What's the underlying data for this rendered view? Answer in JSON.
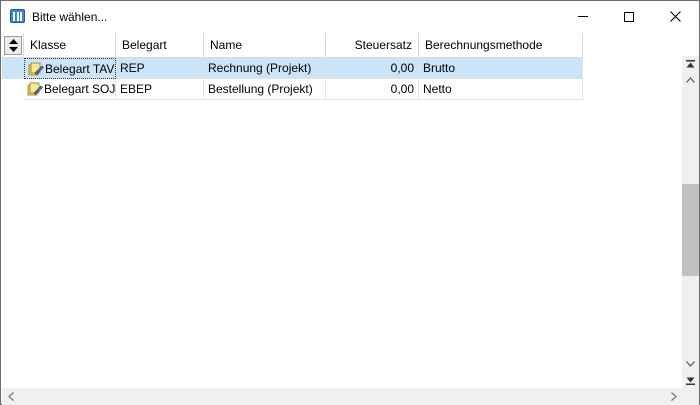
{
  "window": {
    "title": "Bitte wählen..."
  },
  "columns": [
    {
      "key": "klasse",
      "label": "Klasse"
    },
    {
      "key": "belegart",
      "label": "Belegart"
    },
    {
      "key": "name",
      "label": "Name"
    },
    {
      "key": "steuersatz",
      "label": "Steuersatz"
    },
    {
      "key": "methode",
      "label": "Berechnungsmethode"
    }
  ],
  "rows": [
    {
      "klasse": "Belegart TAV",
      "belegart": "REP",
      "name": "Rechnung (Projekt)",
      "steuersatz": "0,00",
      "methode": "Brutto",
      "selected": true
    },
    {
      "klasse": "Belegart SOJ",
      "belegart": "EBEP",
      "name": "Bestellung (Projekt)",
      "steuersatz": "0,00",
      "methode": "Netto",
      "selected": false
    }
  ],
  "icons": {
    "app": "list-window-icon",
    "sort": "sort-updown-icon",
    "row": "document-pencil-icon"
  },
  "colors": {
    "selection": "#cce4f7",
    "app_icon": "#3e86d3"
  }
}
